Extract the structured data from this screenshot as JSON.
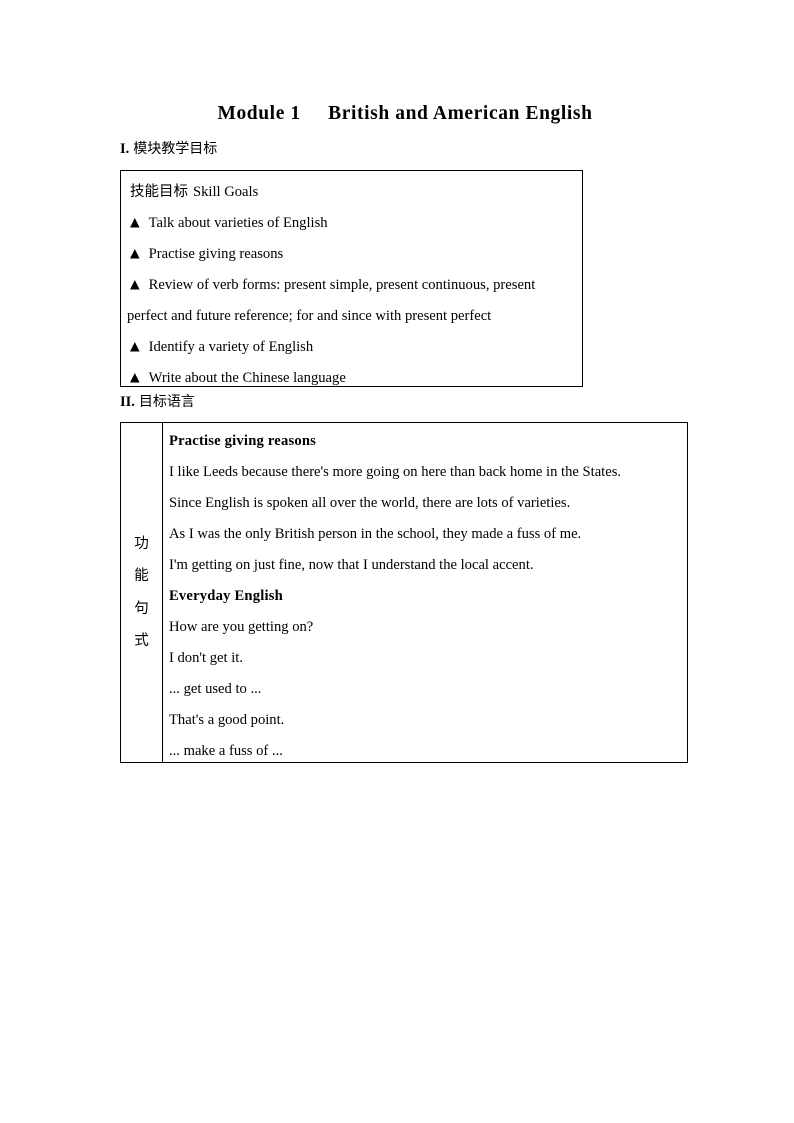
{
  "document": {
    "title": "Module 1     British and American English"
  },
  "sections": [
    {
      "numeral": "I.",
      "cn_title": "模块教学目标"
    },
    {
      "numeral": "II.",
      "cn_title": "目标语言"
    }
  ],
  "skill_goals_box": {
    "header": "技能目标 Skill Goals",
    "header_cn": "技能目标",
    "header_en": "Skill Goals",
    "bullet_glyph": "▲",
    "items": [
      "Talk about varieties of English",
      "Practise giving reasons",
      "Review of verb forms: present simple, present continuous, present",
      "Identify a variety of English",
      "Write about the Chinese language"
    ],
    "continuation_line": "perfect and future reference; for and since with present perfect"
  },
  "target_language_table": {
    "row_label_chars": [
      "功",
      "能",
      "句",
      "式"
    ],
    "subheading_1": "Practise giving reasons",
    "sentences_1": [
      "I like Leeds because there's more going on here than back home in the States.",
      "Since English is spoken all over the world, there are lots of varieties.",
      "As I was the only British person in the school, they made a fuss of me.",
      "I'm getting on just fine, now that I understand the local accent."
    ],
    "subheading_2": "Everyday English",
    "sentences_2": [
      "How are you getting on?",
      "I don't get it.",
      "... get used to ...",
      "That's a good point.",
      "... make a fuss of ..."
    ]
  },
  "colors": {
    "text": "#000000",
    "background": "#ffffff",
    "border": "#000000"
  }
}
